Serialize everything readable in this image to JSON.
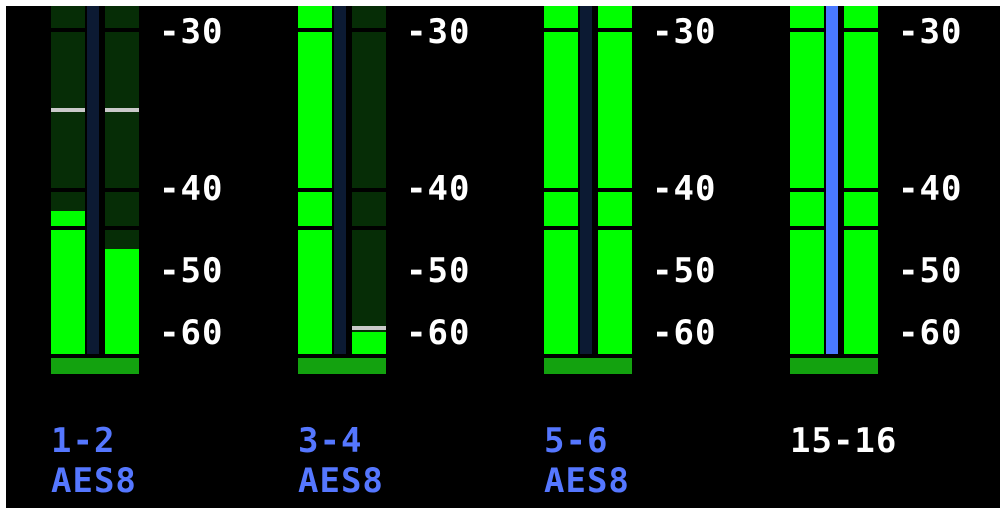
{
  "colors": {
    "lit": "#00ff00",
    "unlit": "#062d06",
    "spine": "#0c1a33",
    "spine_selected": "#4a78ff",
    "base": "#13a20f",
    "peak_hold": "#c9c9c9",
    "label_selected": "#5577ff",
    "label_normal": "#ffffff"
  },
  "scale_labels": [
    "-30",
    "-40",
    "-50",
    "-60"
  ],
  "meters": [
    {
      "name": "1-2",
      "source": "AES8",
      "selected": true,
      "left_level_db": -42,
      "right_level_db": -47,
      "left_peak_db": -32,
      "right_peak_db": -32
    },
    {
      "name": "3-4",
      "source": "AES8",
      "selected": true,
      "left_level_db": -20,
      "right_level_db": -60,
      "left_peak_db": null,
      "right_peak_db": -60
    },
    {
      "name": "5-6",
      "source": "AES8",
      "selected": true,
      "left_level_db": -20,
      "right_level_db": -20,
      "left_peak_db": null,
      "right_peak_db": null
    },
    {
      "name": "15-16",
      "source": "",
      "selected": false,
      "left_level_db": -20,
      "right_level_db": -20,
      "left_peak_db": null,
      "right_peak_db": null
    }
  ]
}
